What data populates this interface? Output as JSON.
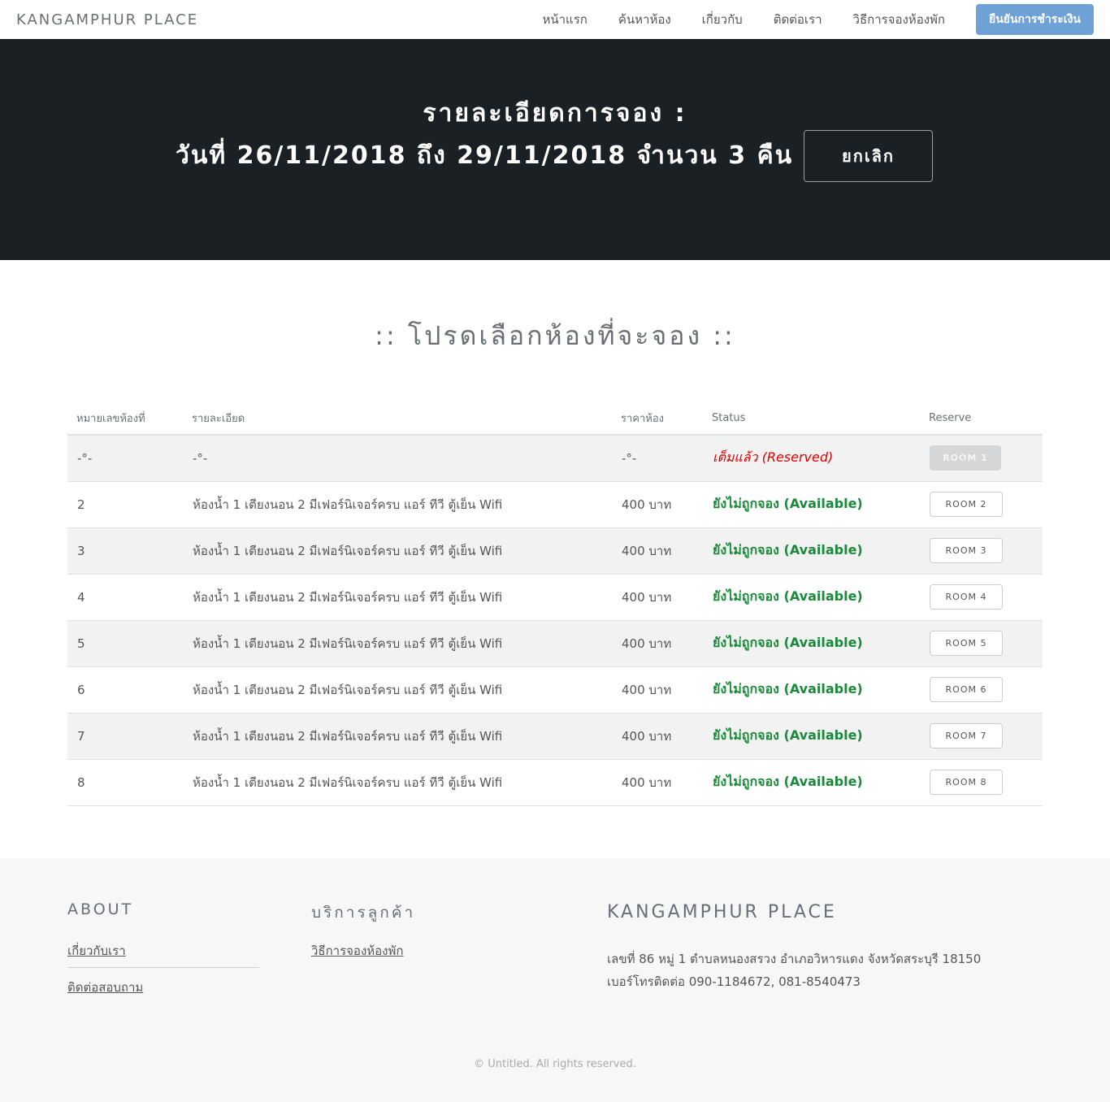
{
  "nav": {
    "brand": "KANGAMPHUR PLACE",
    "links": [
      "หน้าแรก",
      "ค้นหาห้อง",
      "เกี่ยวกับ",
      "ติดต่อเรา",
      "วิธีการจองห้องพัก"
    ],
    "cta": "ยืนยันการชำระเงิน"
  },
  "hero": {
    "line1": "รายละเอียดการจอง :",
    "line2": "วันที่ 26/11/2018 ถึง 29/11/2018 จำนวน 3 คืน",
    "cancel": "ยกเลิก"
  },
  "section": {
    "title": ":: โปรดเลือกห้องที่จะจอง ::"
  },
  "table": {
    "headers": [
      "หมายเลขห้องที่",
      "รายละเอียด",
      "ราคาห้อง",
      "Status",
      "Reserve"
    ],
    "rows": [
      {
        "no": "-°-",
        "detail": "-°-",
        "price": "-°-",
        "status": "เต็มแล้ว (Reserved)",
        "button": "ROOM 1"
      },
      {
        "no": "2",
        "detail": "ห้องน้ำ 1 เตียงนอน 2 มีเฟอร์นิเจอร์ครบ แอร์ ทีวี ตู้เย็น Wifi",
        "price": "400 บาท",
        "status": "ยังไม่ถูกจอง (Available)",
        "button": "ROOM 2"
      },
      {
        "no": "3",
        "detail": "ห้องน้ำ 1 เตียงนอน 2 มีเฟอร์นิเจอร์ครบ แอร์ ทีวี ตู้เย็น Wifi",
        "price": "400 บาท",
        "status": "ยังไม่ถูกจอง (Available)",
        "button": "ROOM 3"
      },
      {
        "no": "4",
        "detail": "ห้องน้ำ 1 เตียงนอน 2 มีเฟอร์นิเจอร์ครบ แอร์ ทีวี ตู้เย็น Wifi",
        "price": "400 บาท",
        "status": "ยังไม่ถูกจอง (Available)",
        "button": "ROOM 4"
      },
      {
        "no": "5",
        "detail": "ห้องน้ำ 1 เตียงนอน 2 มีเฟอร์นิเจอร์ครบ แอร์ ทีวี ตู้เย็น Wifi",
        "price": "400 บาท",
        "status": "ยังไม่ถูกจอง (Available)",
        "button": "ROOM 5"
      },
      {
        "no": "6",
        "detail": "ห้องน้ำ 1 เตียงนอน 2 มีเฟอร์นิเจอร์ครบ แอร์ ทีวี ตู้เย็น Wifi",
        "price": "400 บาท",
        "status": "ยังไม่ถูกจอง (Available)",
        "button": "ROOM 6"
      },
      {
        "no": "7",
        "detail": "ห้องน้ำ 1 เตียงนอน 2 มีเฟอร์นิเจอร์ครบ แอร์ ทีวี ตู้เย็น Wifi",
        "price": "400 บาท",
        "status": "ยังไม่ถูกจอง (Available)",
        "button": "ROOM 7"
      },
      {
        "no": "8",
        "detail": "ห้องน้ำ 1 เตียงนอน 2 มีเฟอร์นิเจอร์ครบ แอร์ ทีวี ตู้เย็น Wifi",
        "price": "400 บาท",
        "status": "ยังไม่ถูกจอง (Available)",
        "button": "ROOM 8"
      }
    ]
  },
  "footer": {
    "about_heading": "ABOUT",
    "about_links": [
      "เกี่ยวกับเรา",
      "ติดต่อสอบถาม"
    ],
    "service_heading": "บริการลูกค้า",
    "service_links": [
      "วิธีการจองห้องพัก"
    ],
    "place_heading": "KANGAMPHUR PLACE",
    "address": "เลขที่ 86 หมู่ 1 ตำบลหนองสรวง อำเภอวิหารแดง จังหวัดสระบุรี 18150",
    "phone": "เบอร์โทรติดต่อ 090-1184672, 081-8540473",
    "copyright": "© Untitled. All rights reserved."
  },
  "colors": {
    "hero_bg": "#1b2024",
    "cta_bg": "#6ea2d6",
    "reserved": "#e00000",
    "available": "#1a8a3a",
    "footer_bg": "#f7f7f7"
  }
}
